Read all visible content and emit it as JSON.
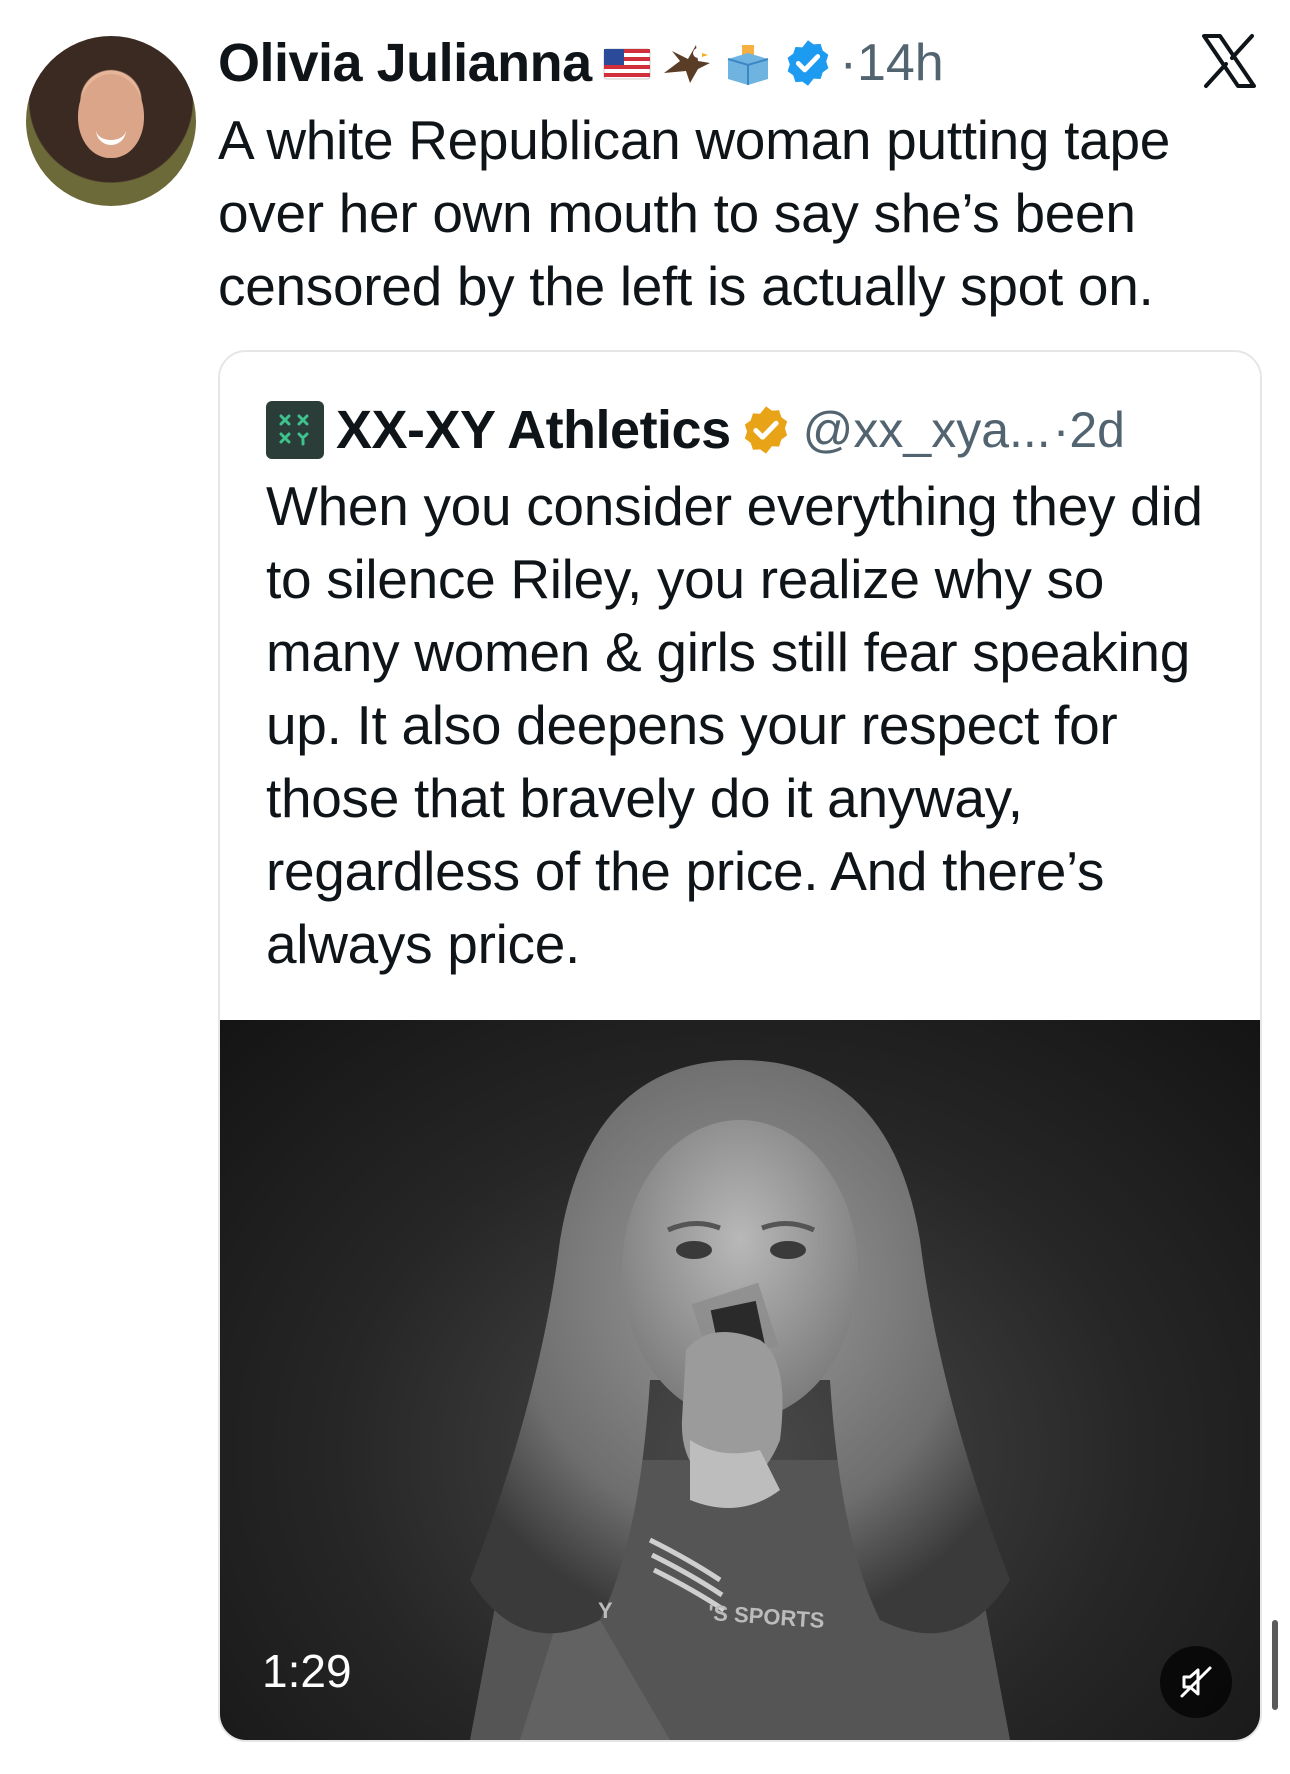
{
  "tweet": {
    "author_name": "Olivia Julianna",
    "time": "·14h",
    "text": "A white Republican woman putting tape over her own mouth to say she’s been censored by the left is actually spot on.",
    "emojis": [
      "us-flag",
      "eagle",
      "ballot-box"
    ]
  },
  "quote": {
    "author_name": "XX-XY Athletics",
    "handle": "@xx_xya...",
    "time": "·2d",
    "text": "When you consider everything they did to silence Riley, you realize why so many women & girls still fear speaking up. It also deepens your respect for those that bravely do it anyway, regardless of the price. And there’s always price.",
    "logo_text": "XX XY"
  },
  "video": {
    "duration": "1:29",
    "shirt_text": "'S SPORTS",
    "shirt_text_left": "Y"
  },
  "colors": {
    "verified_blue": "#1d9bf0",
    "verified_gold": "#e8a317",
    "secondary_text": "#536471"
  }
}
